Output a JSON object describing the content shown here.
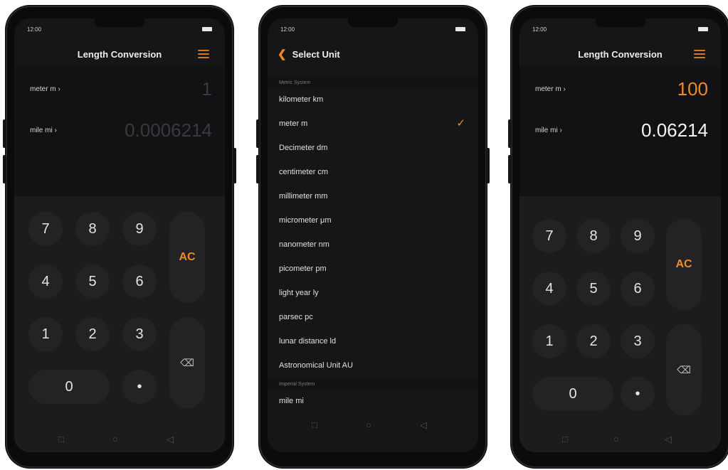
{
  "status": {
    "time_left": "12:00",
    "time_mid": "12:00",
    "time_right": "12:00"
  },
  "screen_left": {
    "title": "Length Conversion",
    "from_unit": "meter m",
    "from_value": "1",
    "to_unit": "mile mi",
    "to_value": "0.0006214"
  },
  "screen_mid": {
    "title": "Select Unit",
    "section_metric": "Metric System",
    "metric_units": [
      "kilometer km",
      "meter m",
      "Decimeter dm",
      "centimeter cm",
      "millimeter mm",
      "micrometer μm",
      "nanometer nm",
      "picometer pm",
      "light year ly",
      "parsec pc",
      "lunar distance ld",
      "Astronomical Unit AU"
    ],
    "selected_unit": "meter m",
    "section_imperial": "Imperial System",
    "imperial_units": [
      "mile mi"
    ]
  },
  "screen_right": {
    "title": "Length Conversion",
    "from_unit": "meter m",
    "from_value": "100",
    "to_unit": "mile mi",
    "to_value": "0.06214"
  },
  "keypad": {
    "k7": "7",
    "k8": "8",
    "k9": "9",
    "k4": "4",
    "k5": "5",
    "k6": "6",
    "k1": "1",
    "k2": "2",
    "k3": "3",
    "k0": "0",
    "dot": "•",
    "ac": "AC",
    "del": "⌫"
  },
  "nav": {
    "recent": "□",
    "home": "○",
    "back": "◁"
  },
  "unit_arrow": "›",
  "colors": {
    "accent": "#f28a24",
    "background": "#161618",
    "keypad": "#1c1c1e"
  }
}
